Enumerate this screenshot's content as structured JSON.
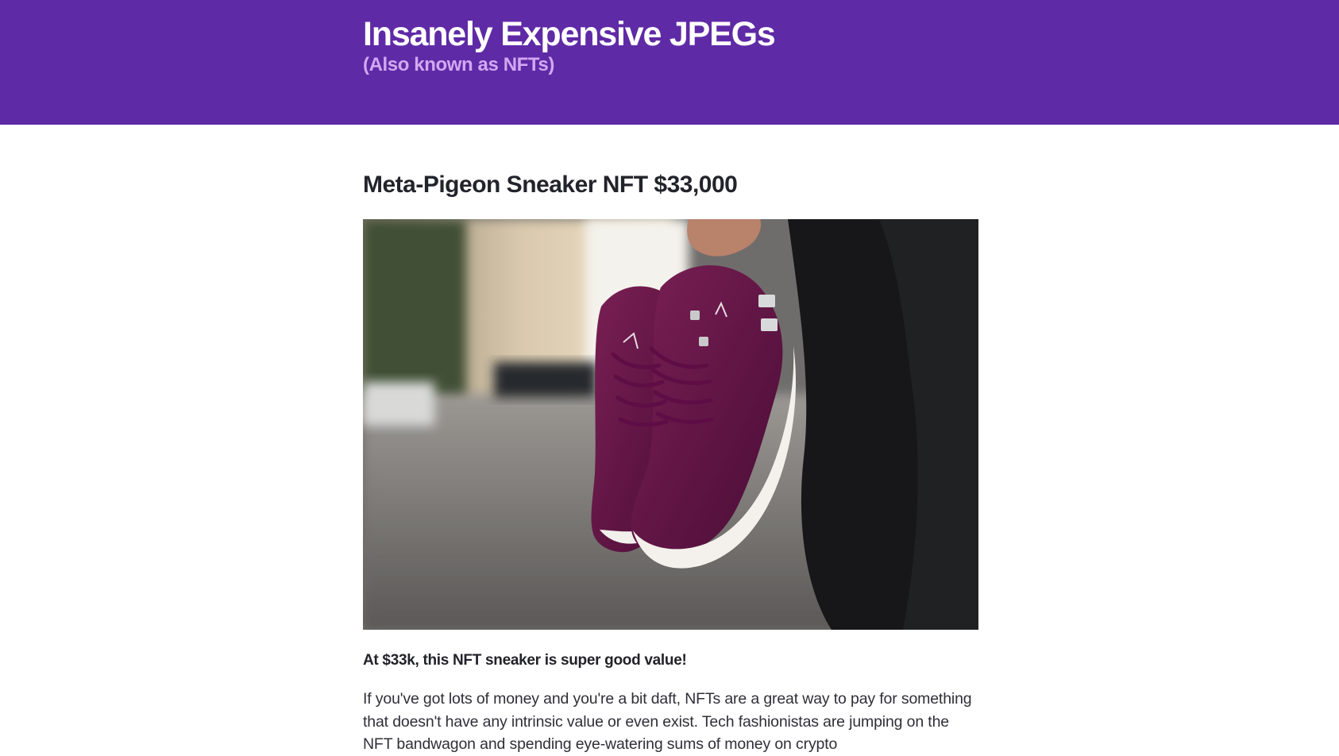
{
  "header": {
    "title": "Insanely Expensive JPEGs",
    "subtitle": "(Also known as NFTs)"
  },
  "article": {
    "title": "Meta-Pigeon Sneaker NFT $33,000",
    "image_description": "purple-sneakers-photo",
    "lead": "At $33k, this NFT sneaker is super good value!",
    "body": "If you've got lots of money and you're a bit daft, NFTs are a great way to pay for something that doesn't have any intrinsic value or even exist. Tech fashionistas are jumping on the NFT bandwagon and spending eye-watering sums of money on crypto"
  },
  "colors": {
    "header_bg": "#5f2aa6",
    "title": "#ffffff",
    "subtitle": "#d3a8f2",
    "text": "#2f2f38"
  }
}
